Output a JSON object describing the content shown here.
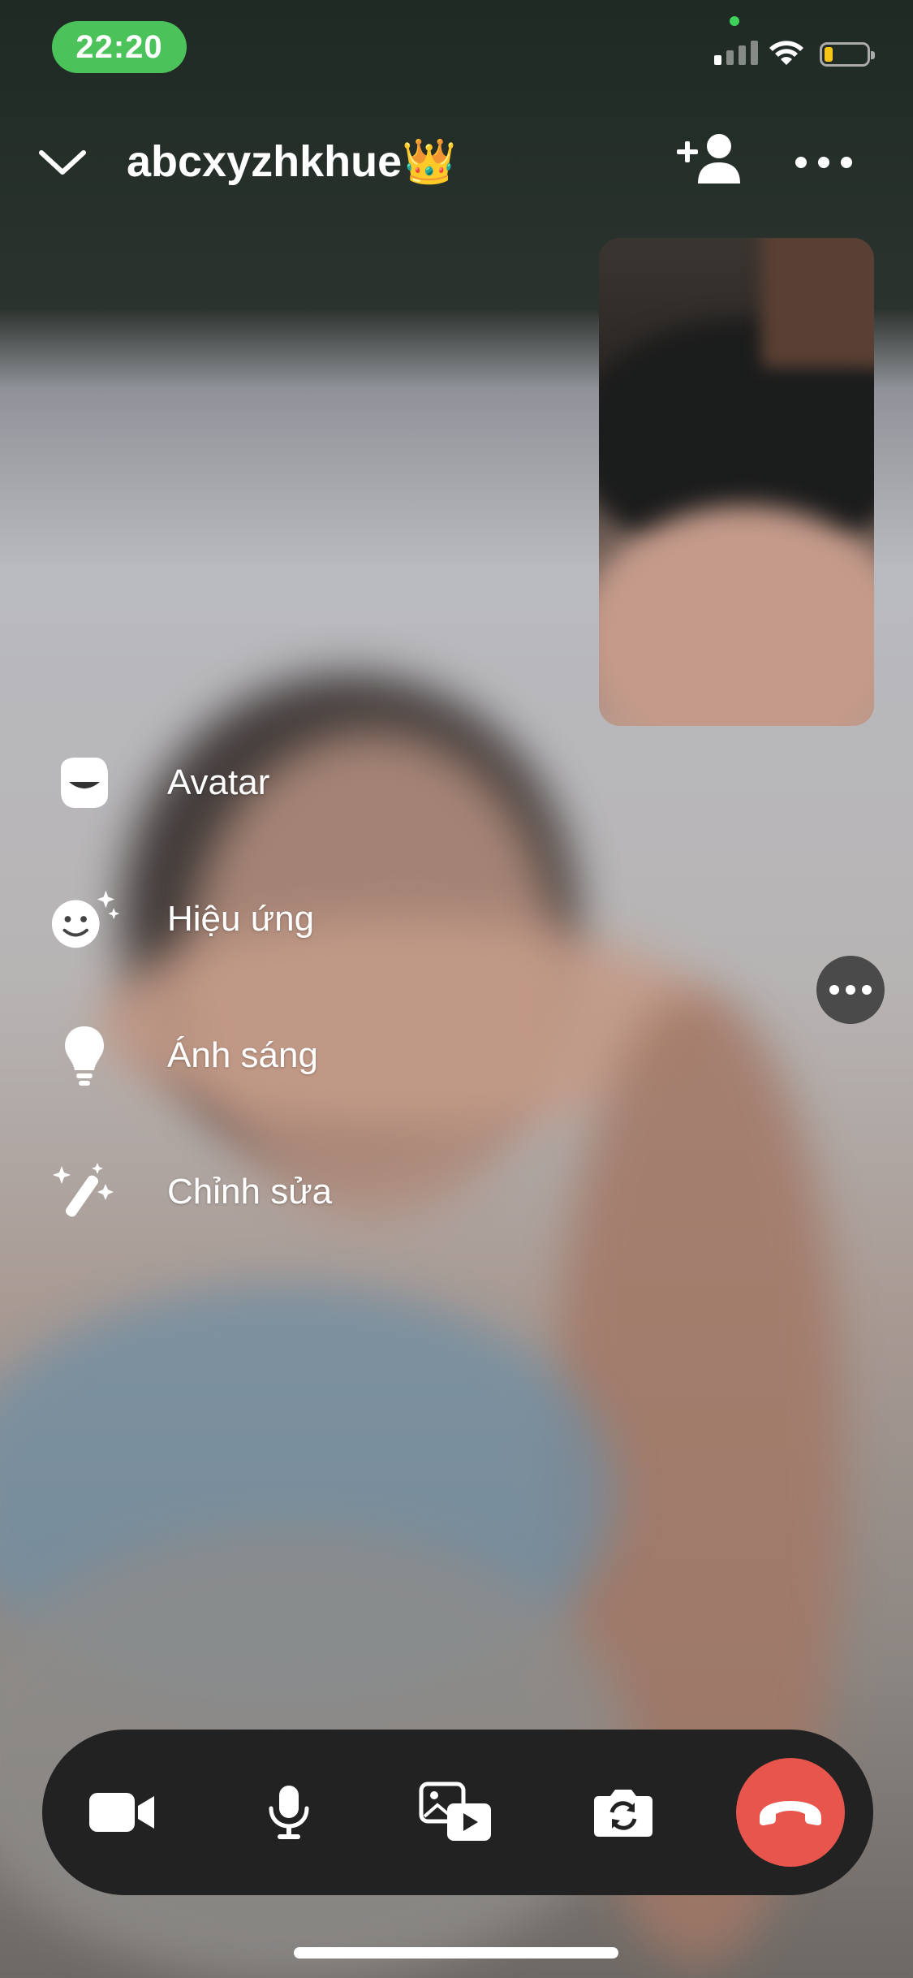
{
  "status_bar": {
    "time": "22:20"
  },
  "header": {
    "title": "abcxyzhkhue👑"
  },
  "menu": {
    "items": [
      {
        "label": "Avatar",
        "icon": "avatar-icon"
      },
      {
        "label": "Hiệu ứng",
        "icon": "effects-icon"
      },
      {
        "label": "Ánh sáng",
        "icon": "lightbulb-icon"
      },
      {
        "label": "Chỉnh sửa",
        "icon": "magic-wand-icon"
      }
    ]
  },
  "controls": {
    "buttons": [
      "video-camera-icon",
      "microphone-icon",
      "media-share-icon",
      "switch-camera-icon",
      "end-call-icon"
    ]
  },
  "colors": {
    "status_pill": "#4cc25a",
    "end_call": "#e8554d",
    "control_bar": "#222222"
  }
}
